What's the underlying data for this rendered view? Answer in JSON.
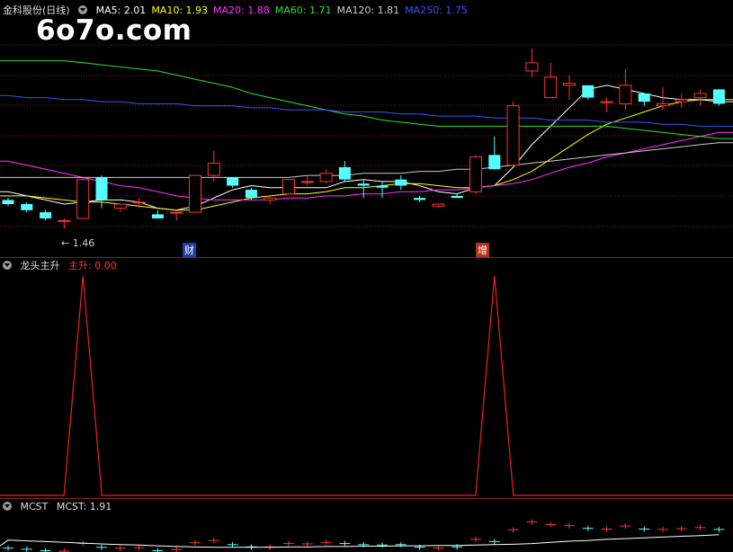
{
  "main_panel": {
    "stock_title": "金科股份(日线)",
    "ma_labels": [
      {
        "text": "MA5: 2.01",
        "color": "#ffffff"
      },
      {
        "text": "MA10: 1.93",
        "color": "#ffff00"
      },
      {
        "text": "MA20: 1.88",
        "color": "#ff33ff"
      },
      {
        "text": "MA60: 1.71",
        "color": "#33dd33"
      },
      {
        "text": "MA120: 1.81",
        "color": "#cccccc"
      },
      {
        "text": "MA250: 1.75",
        "color": "#3355ff"
      }
    ],
    "low_price_label": "1.46",
    "event_markers": [
      "财",
      "增"
    ],
    "watermark": "6o7o.com"
  },
  "indicator_panel": {
    "title": "龙头主升",
    "value_label": "主升: 0.00",
    "value_color": "#ff3333"
  },
  "mcst_panel": {
    "title": "MCST",
    "value_label": "MCST: 1.91"
  },
  "colors": {
    "up_candle": "#ff3333",
    "down_candle": "#54ffff",
    "grid": "#8a1a1a",
    "signal_line": "#ee2222"
  },
  "chart_data": {
    "type": "candlestick",
    "candles": [
      {
        "o": 1.6,
        "h": 1.61,
        "l": 1.57,
        "c": 1.58
      },
      {
        "o": 1.58,
        "h": 1.59,
        "l": 1.54,
        "c": 1.55
      },
      {
        "o": 1.54,
        "h": 1.55,
        "l": 1.5,
        "c": 1.51
      },
      {
        "o": 1.5,
        "h": 1.51,
        "l": 1.46,
        "c": 1.5
      },
      {
        "o": 1.51,
        "h": 1.71,
        "l": 1.51,
        "c": 1.7
      },
      {
        "o": 1.71,
        "h": 1.72,
        "l": 1.56,
        "c": 1.6
      },
      {
        "o": 1.56,
        "h": 1.58,
        "l": 1.54,
        "c": 1.58
      },
      {
        "o": 1.59,
        "h": 1.61,
        "l": 1.56,
        "c": 1.59
      },
      {
        "o": 1.53,
        "h": 1.55,
        "l": 1.51,
        "c": 1.51
      },
      {
        "o": 1.54,
        "h": 1.54,
        "l": 1.5,
        "c": 1.54
      },
      {
        "o": 1.54,
        "h": 1.72,
        "l": 1.54,
        "c": 1.72
      },
      {
        "o": 1.72,
        "h": 1.84,
        "l": 1.69,
        "c": 1.78
      },
      {
        "o": 1.71,
        "h": 1.71,
        "l": 1.66,
        "c": 1.67
      },
      {
        "o": 1.65,
        "h": 1.66,
        "l": 1.6,
        "c": 1.61
      },
      {
        "o": 1.6,
        "h": 1.62,
        "l": 1.58,
        "c": 1.61
      },
      {
        "o": 1.63,
        "h": 1.7,
        "l": 1.63,
        "c": 1.7
      },
      {
        "o": 1.69,
        "h": 1.72,
        "l": 1.67,
        "c": 1.69
      },
      {
        "o": 1.69,
        "h": 1.75,
        "l": 1.68,
        "c": 1.73
      },
      {
        "o": 1.76,
        "h": 1.79,
        "l": 1.69,
        "c": 1.7
      },
      {
        "o": 1.68,
        "h": 1.7,
        "l": 1.61,
        "c": 1.67
      },
      {
        "o": 1.67,
        "h": 1.69,
        "l": 1.61,
        "c": 1.66
      },
      {
        "o": 1.7,
        "h": 1.72,
        "l": 1.65,
        "c": 1.67
      },
      {
        "o": 1.61,
        "h": 1.62,
        "l": 1.59,
        "c": 1.6
      },
      {
        "o": 1.57,
        "h": 1.58,
        "l": 1.56,
        "c": 1.58
      },
      {
        "o": 1.62,
        "h": 1.63,
        "l": 1.61,
        "c": 1.61
      },
      {
        "o": 1.64,
        "h": 1.82,
        "l": 1.63,
        "c": 1.81
      },
      {
        "o": 1.82,
        "h": 1.91,
        "l": 1.75,
        "c": 1.75
      },
      {
        "o": 1.77,
        "h": 2.08,
        "l": 1.77,
        "c": 2.06
      },
      {
        "o": 2.23,
        "h": 2.34,
        "l": 2.2,
        "c": 2.27
      },
      {
        "o": 2.1,
        "h": 2.27,
        "l": 2.1,
        "c": 2.2
      },
      {
        "o": 2.16,
        "h": 2.21,
        "l": 2.09,
        "c": 2.17
      },
      {
        "o": 2.16,
        "h": 2.16,
        "l": 2.09,
        "c": 2.1
      },
      {
        "o": 2.08,
        "h": 2.1,
        "l": 2.03,
        "c": 2.08
      },
      {
        "o": 2.07,
        "h": 2.24,
        "l": 2.04,
        "c": 2.16
      },
      {
        "o": 2.12,
        "h": 2.12,
        "l": 2.06,
        "c": 2.08
      },
      {
        "o": 2.06,
        "h": 2.15,
        "l": 2.04,
        "c": 2.07
      },
      {
        "o": 2.08,
        "h": 2.12,
        "l": 2.05,
        "c": 2.09
      },
      {
        "o": 2.1,
        "h": 2.14,
        "l": 2.06,
        "c": 2.12
      },
      {
        "o": 2.14,
        "h": 2.14,
        "l": 2.06,
        "c": 2.07
      }
    ],
    "ma_lines": {
      "MA5": [
        1.64,
        1.62,
        1.6,
        1.58,
        1.59,
        1.6,
        1.6,
        1.59,
        1.56,
        1.55,
        1.57,
        1.61,
        1.65,
        1.67,
        1.66,
        1.66,
        1.66,
        1.66,
        1.69,
        1.7,
        1.69,
        1.69,
        1.67,
        1.64,
        1.63,
        1.66,
        1.67,
        1.76,
        1.87,
        1.96,
        2.05,
        2.14,
        2.16,
        2.14,
        2.12,
        2.1,
        2.09,
        2.09,
        2.08
      ],
      "MA10": [
        1.62,
        1.62,
        1.61,
        1.6,
        1.59,
        1.59,
        1.58,
        1.57,
        1.56,
        1.55,
        1.55,
        1.57,
        1.59,
        1.61,
        1.62,
        1.63,
        1.63,
        1.64,
        1.66,
        1.66,
        1.67,
        1.68,
        1.68,
        1.67,
        1.66,
        1.66,
        1.67,
        1.7,
        1.74,
        1.8,
        1.86,
        1.92,
        1.97,
        2.0,
        2.03,
        2.06,
        2.08,
        2.09,
        2.09
      ],
      "MA20": [
        1.79,
        1.77,
        1.75,
        1.73,
        1.71,
        1.69,
        1.67,
        1.66,
        1.64,
        1.62,
        1.61,
        1.6,
        1.6,
        1.6,
        1.6,
        1.61,
        1.61,
        1.62,
        1.62,
        1.63,
        1.63,
        1.64,
        1.64,
        1.65,
        1.65,
        1.66,
        1.67,
        1.68,
        1.7,
        1.73,
        1.76,
        1.78,
        1.81,
        1.83,
        1.85,
        1.87,
        1.89,
        1.91,
        1.93
      ],
      "MA60": [
        2.28,
        2.28,
        2.28,
        2.28,
        2.27,
        2.26,
        2.25,
        2.24,
        2.23,
        2.21,
        2.19,
        2.17,
        2.15,
        2.12,
        2.1,
        2.08,
        2.06,
        2.04,
        2.02,
        2.01,
        1.99,
        1.98,
        1.97,
        1.96,
        1.96,
        1.96,
        1.96,
        1.96,
        1.96,
        1.96,
        1.96,
        1.96,
        1.96,
        1.95,
        1.94,
        1.93,
        1.92,
        1.91,
        1.9
      ],
      "MA120": [
        1.71,
        1.71,
        1.71,
        1.71,
        1.71,
        1.71,
        1.71,
        1.71,
        1.71,
        1.71,
        1.71,
        1.71,
        1.71,
        1.71,
        1.71,
        1.71,
        1.72,
        1.72,
        1.72,
        1.73,
        1.73,
        1.73,
        1.74,
        1.74,
        1.75,
        1.75,
        1.76,
        1.77,
        1.78,
        1.79,
        1.8,
        1.81,
        1.82,
        1.83,
        1.84,
        1.85,
        1.86,
        1.87,
        1.88
      ],
      "MA250": [
        2.11,
        2.1,
        2.1,
        2.09,
        2.09,
        2.08,
        2.08,
        2.07,
        2.07,
        2.07,
        2.06,
        2.06,
        2.06,
        2.05,
        2.05,
        2.04,
        2.04,
        2.04,
        2.03,
        2.03,
        2.03,
        2.02,
        2.02,
        2.01,
        2.01,
        2.01,
        2.0,
        2.0,
        2.0,
        1.99,
        1.99,
        1.99,
        1.98,
        1.98,
        1.98,
        1.97,
        1.97,
        1.96,
        1.96
      ]
    },
    "signal": [
      0,
      0,
      0,
      0,
      1,
      0,
      0,
      0,
      0,
      0,
      0,
      0,
      0,
      0,
      0,
      0,
      0,
      0,
      0,
      0,
      0,
      0,
      0,
      0,
      0,
      0,
      1,
      0,
      0,
      0,
      0,
      0,
      0,
      0,
      0,
      0,
      0,
      0,
      0
    ],
    "price_range": [
      1.4,
      2.48
    ]
  }
}
